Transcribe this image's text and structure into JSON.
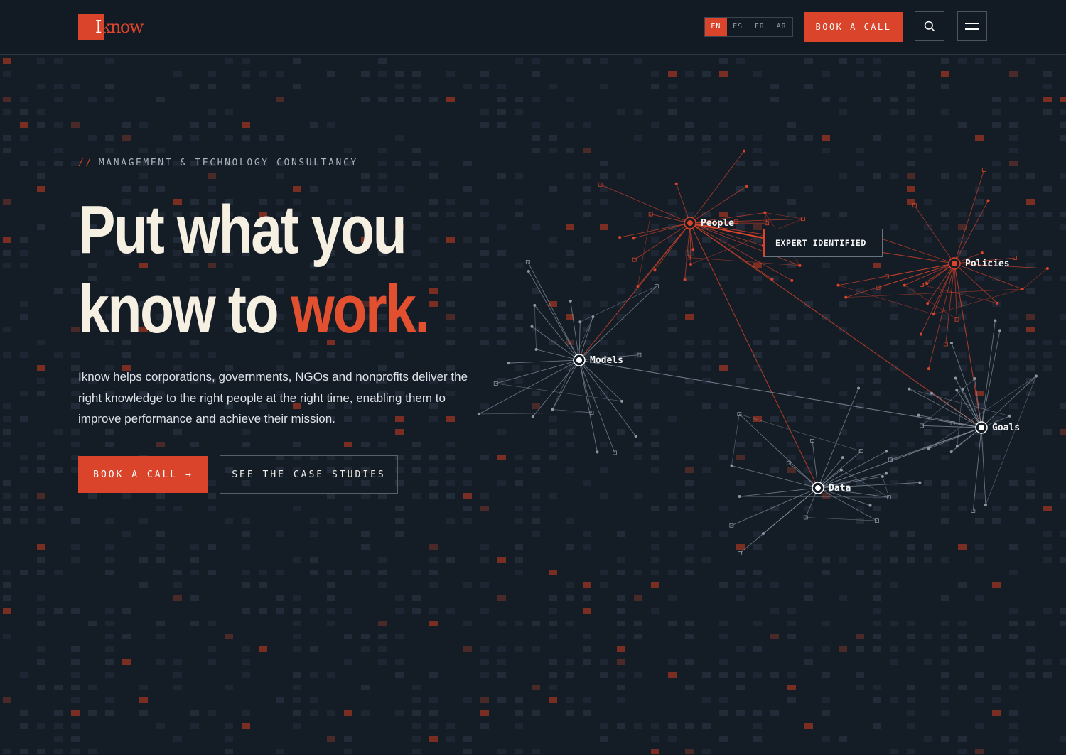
{
  "colors": {
    "accent": "#d9442a",
    "background": "#141c26",
    "headline": "#f6f0e3",
    "line_orange": "#d9442a",
    "line_gray": "#8b98a6"
  },
  "header": {
    "logo_text": "Iknow",
    "logo_initial": "I",
    "logo_rest": "know",
    "languages": [
      "EN",
      "ES",
      "FR",
      "AR"
    ],
    "active_language": "EN",
    "book_label": "BOOK A CALL",
    "search_icon": "search-icon",
    "menu_icon": "hamburger-menu-icon"
  },
  "hero": {
    "eyebrow_prefix": "//",
    "eyebrow": "MANAGEMENT & TECHNOLOGY CONSULTANCY",
    "headline_line1": "Put what you",
    "headline_line2_start": "know to ",
    "headline_accent": "work.",
    "description": "Iknow helps corporations, governments, NGOs and nonprofits deliver the right knowledge to the right people at the right time, enabling them to improve performance and achieve their mission.",
    "cta_primary": "BOOK A CALL →",
    "cta_secondary": "SEE THE CASE STUDIES"
  },
  "network": {
    "nodes": [
      "People",
      "Policies",
      "Models",
      "Data",
      "Goals"
    ],
    "highlighted_nodes": [
      "People",
      "Policies"
    ],
    "callout": "EXPERT IDENTIFIED"
  }
}
